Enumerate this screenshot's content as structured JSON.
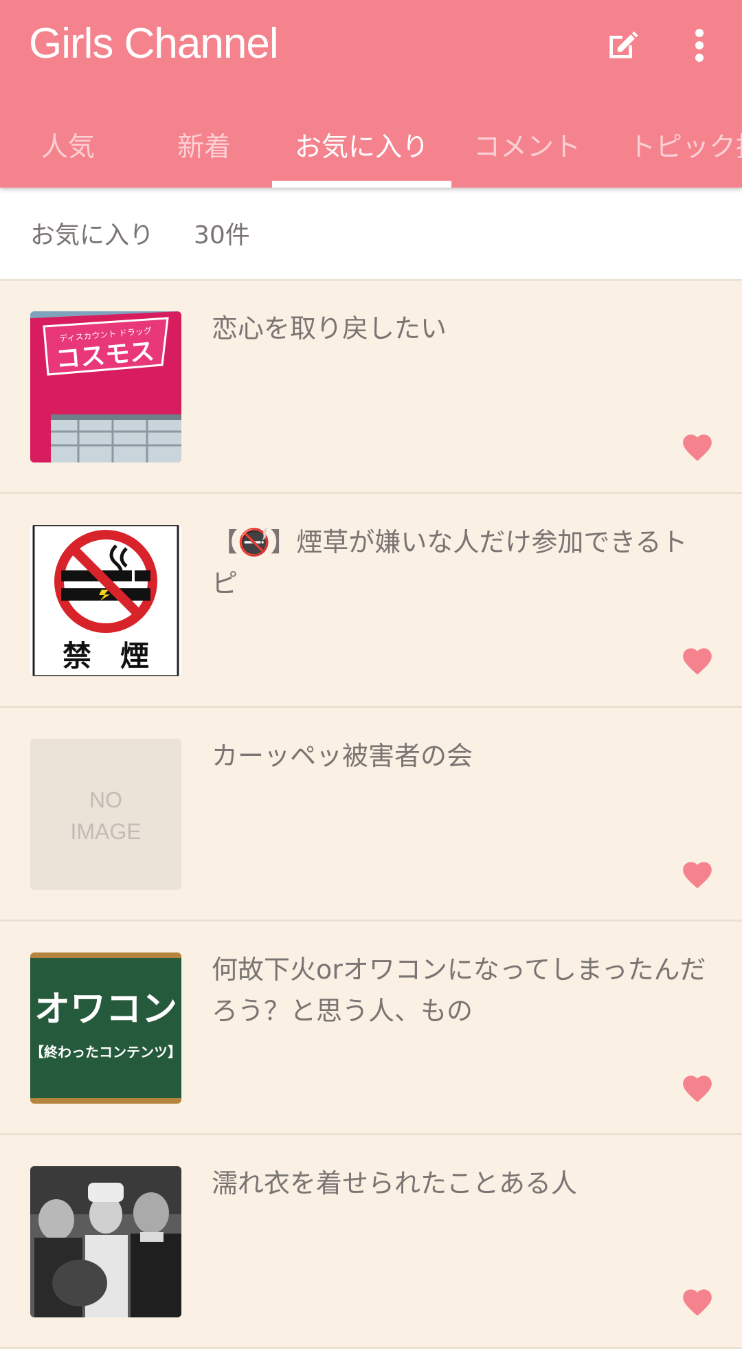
{
  "app": {
    "title": "Girls Channel"
  },
  "toolbar": {
    "edit_icon": "edit-icon",
    "more_icon": "more-vert-icon"
  },
  "tabs": [
    {
      "label": "人気",
      "active": false
    },
    {
      "label": "新着",
      "active": false
    },
    {
      "label": "お気に入り",
      "active": true
    },
    {
      "label": "コメント",
      "active": false
    },
    {
      "label": "トピック投",
      "active": false
    }
  ],
  "favorites": {
    "label": "お気に入り",
    "count": "30件"
  },
  "items": [
    {
      "title": "恋心を取り戻したい",
      "thumb": "store-sign-photo",
      "sign_text": "コスモス",
      "sign_subtext": "ディスカウント ドラッグ",
      "favorited": true
    },
    {
      "title": "【🚭】煙草が嫌いな人だけ参加できるトピ",
      "thumb": "no-smoking-sign",
      "sign_text": "禁　煙",
      "favorited": true
    },
    {
      "title": "カーッペッ被害者の会",
      "thumb": "no-image-placeholder",
      "placeholder_line1": "NO",
      "placeholder_line2": "IMAGE",
      "favorited": true
    },
    {
      "title": "何故下火orオワコンになってしまったんだろう？と思う人、もの",
      "thumb": "owakon-blackboard",
      "board_text": "オワコン",
      "board_subtext": "【終わったコンテンツ】",
      "favorited": true
    },
    {
      "title": "濡れ衣を着せられたことある人",
      "thumb": "old-film-photo",
      "favorited": true
    }
  ],
  "colors": {
    "accent": "#f5838e",
    "background": "#faf0e4",
    "text": "#7a7472",
    "heart": "#f5838e"
  }
}
